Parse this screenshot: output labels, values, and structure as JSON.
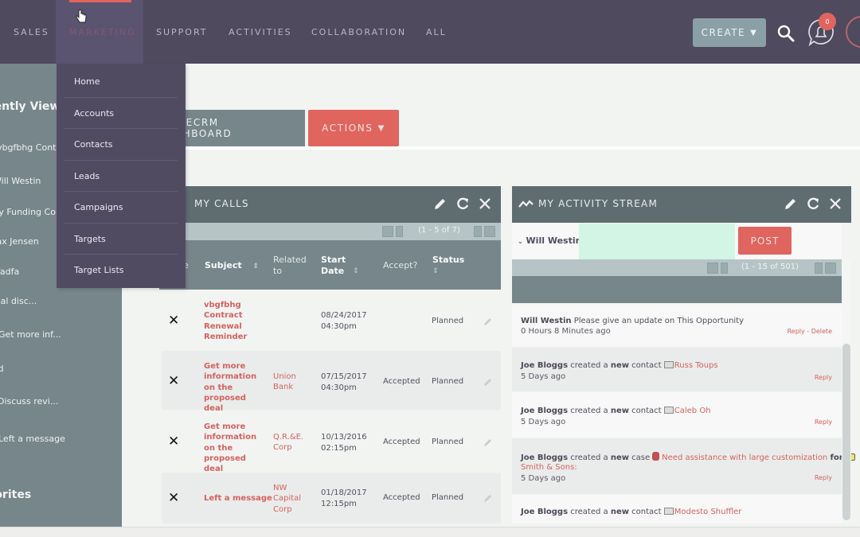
{
  "topnav": {
    "items": [
      "SALES",
      "MARKETING",
      "SUPPORT",
      "ACTIVITIES",
      "COLLABORATION",
      "ALL"
    ],
    "active": "MARKETING",
    "create_label": "CREATE",
    "notification_count": "0"
  },
  "marketing_menu": {
    "items": [
      "Home",
      "Accounts",
      "Contacts",
      "Leads",
      "Campaigns",
      "Targets",
      "Target Lists"
    ]
  },
  "sidebar": {
    "recently_viewed_heading": "Recently Viewed",
    "recent_items": [
      "vbgfbhg Cont...",
      "Will Westin",
      "Tray Funding Co",
      "Max Jensen",
      "fadfa",
      "Initial disc...",
      "Get more inf...",
      "hand",
      "Discuss revi...",
      "Left a message"
    ],
    "favorites_heading": "Favorites"
  },
  "dashboard": {
    "tab_label": "SUITECRM DASHBOARD",
    "actions_label": "ACTIONS"
  },
  "my_calls": {
    "title": "MY CALLS",
    "pagination": "(1 - 5 of 7)",
    "columns": [
      "Close",
      "Subject",
      "Related to",
      "Start Date",
      "Accept?",
      "Status"
    ],
    "rows": [
      {
        "subject": "vbgfbhg Contract Renewal Reminder",
        "related": "",
        "date": "08/24/2017",
        "time": "04:30pm",
        "accept": "",
        "status": "Planned"
      },
      {
        "subject": "Get more information on the proposed deal",
        "related": "Union Bank",
        "date": "07/15/2017",
        "time": "04:30pm",
        "accept": "Accepted",
        "status": "Planned"
      },
      {
        "subject": "Get more information on the proposed deal",
        "related": "Q.R.&E. Corp",
        "date": "10/13/2016",
        "time": "02:15pm",
        "accept": "Accepted",
        "status": "Planned"
      },
      {
        "subject": "Left a message",
        "related": "NW Capital Corp",
        "date": "01/18/2017",
        "time": "12:15pm",
        "accept": "Accepted",
        "status": "Planned"
      }
    ]
  },
  "activity_stream": {
    "title": "MY ACTIVITY STREAM",
    "user": "Will Westin",
    "post_input_value": "",
    "post_label": "POST",
    "pagination": "(1 - 15 of 501)",
    "items": [
      {
        "actor": "Will Westin",
        "text": "Please give an update on This Opportunity",
        "time": "0 Hours 8 Minutes ago",
        "actions": "Reply - Delete"
      },
      {
        "actor": "Joe Bloggs",
        "verb": "created a",
        "new": "new",
        "type": "contact",
        "link": "Russ Toups",
        "time": "5 Days ago",
        "actions": "Reply"
      },
      {
        "actor": "Joe Bloggs",
        "verb": "created a",
        "new": "new",
        "type": "contact",
        "link": "Caleb Oh",
        "time": "5 Days ago",
        "actions": "Reply"
      },
      {
        "actor": "Joe Bloggs",
        "verb": "created a",
        "new": "new",
        "type": "case",
        "link": "Need assistance with large customization",
        "for": "for",
        "account": "Smith & Sons:",
        "time": "5 Days ago",
        "actions": "Reply"
      },
      {
        "actor": "Joe Bloggs",
        "verb": "created a",
        "new": "new",
        "type": "contact",
        "link": "Modesto Shuffler",
        "time": "",
        "actions": ""
      }
    ]
  },
  "colors": {
    "nav_bg": "#4f4a5e",
    "accent": "#e0655f",
    "sidebar_bg": "#76868a",
    "dashlet_header": "#5f6d71",
    "post_input_bg": "#d2f5e6"
  }
}
